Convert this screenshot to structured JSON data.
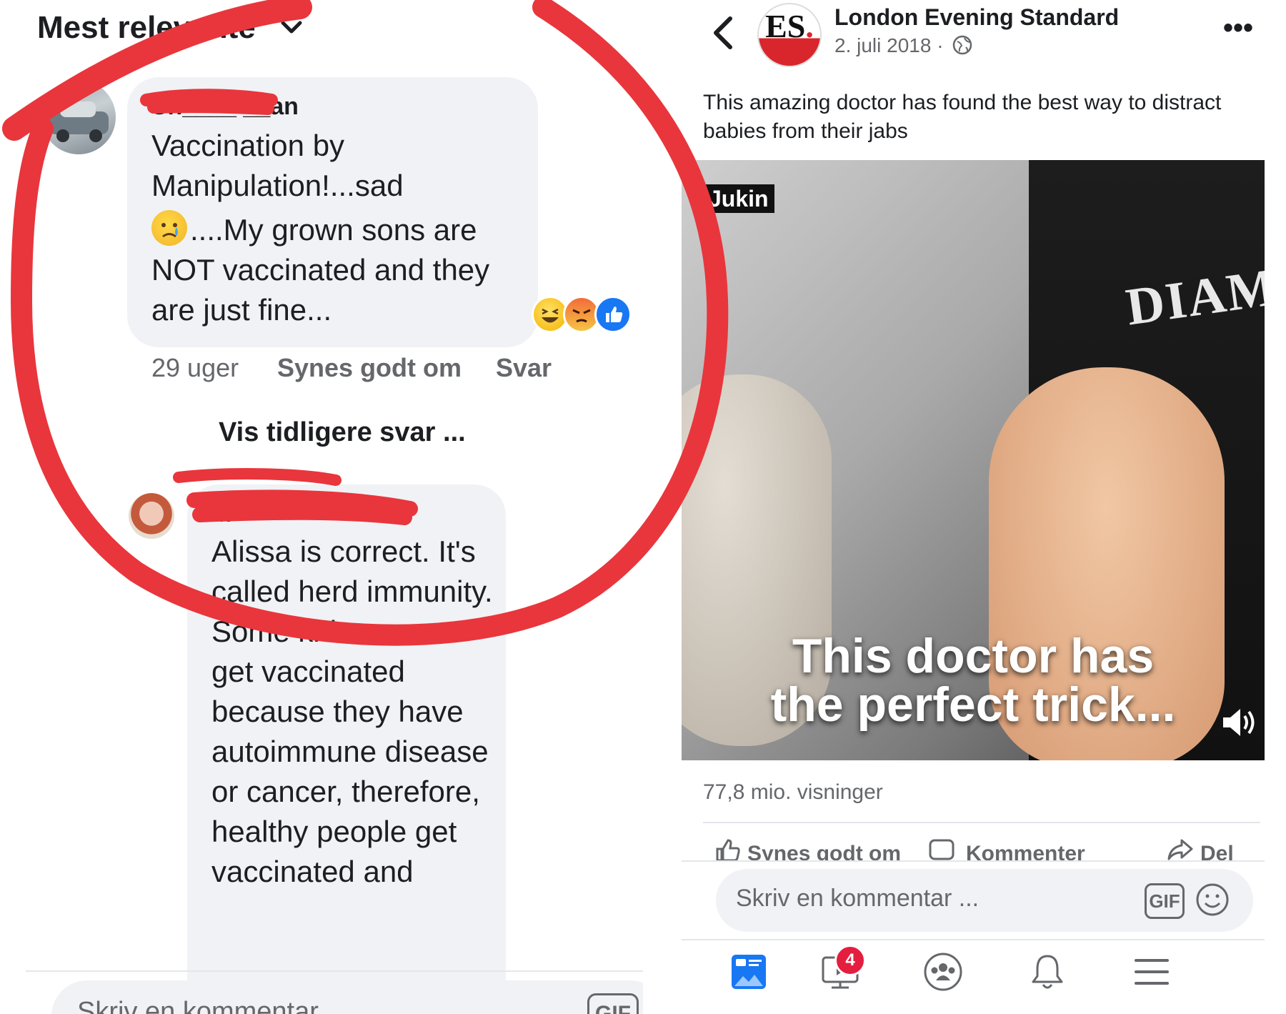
{
  "left": {
    "sort_label": "Mest relevante",
    "comment1": {
      "author": "Ch____ __an",
      "lines": [
        "Vaccination by",
        "Manipulation!...sad"
      ],
      "lines_after_emoji": "....My grown sons are NOT vaccinated and they are just fine...",
      "emoji": "crying-face",
      "time": "29 uger",
      "like_label": "Synes godt om",
      "reply_label": "Svar",
      "reactions": [
        "haha",
        "angry",
        "like"
      ]
    },
    "more_replies": "Vis tidligere svar ...",
    "comment2": {
      "author": "M",
      "text": "Alissa is correct. It's called herd immunity. Some kids cannot get vaccinated because they have autoimmune disease or cancer, therefore, healthy people get vaccinated and"
    },
    "input_placeholder": "Skriv en kommentar ...",
    "gif_label": "GIF"
  },
  "right": {
    "page_name": "London Evening Standard",
    "page_logo": "ES",
    "post_date": "2. juli 2018 ·",
    "caption": "This amazing doctor has found the best way to distract babies from their jabs",
    "video": {
      "watermark": "Jukin",
      "shirt_text": "DIAM",
      "overlay_line1": "This doctor has",
      "overlay_line2": "the perfect trick..."
    },
    "views": "77,8 mio. visninger",
    "actions": {
      "like": "Synes godt om",
      "comment": "Kommenter",
      "share": "Del"
    },
    "input_placeholder": "Skriv en kommentar ...",
    "gif_label": "GIF",
    "notification_badge": "4"
  },
  "colors": {
    "marker_red": "#e8363c",
    "bubble_grey": "#f0f2f5",
    "fb_blue": "#1877f2",
    "secondary_text": "#65676b"
  }
}
